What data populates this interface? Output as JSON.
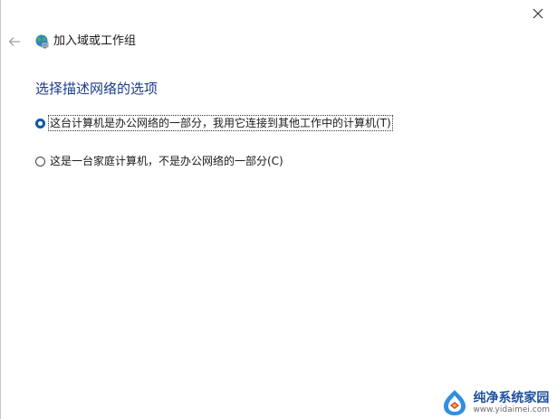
{
  "window": {
    "title": "加入域或工作组"
  },
  "main": {
    "heading": "选择描述网络的选项",
    "options": [
      {
        "label": "这台计算机是办公网络的一部分，我用它连接到其他工作中的计算机(T)",
        "selected": true
      },
      {
        "label": "这是一台家庭计算机，不是办公网络的一部分(C)",
        "selected": false
      }
    ]
  },
  "watermark": {
    "name": "纯净系统家园",
    "url": "www.yidaimei.com"
  },
  "colors": {
    "heading": "#1c3a8a",
    "radio_selected": "#0a58a8",
    "watermark": "#1e4fa0"
  },
  "icons": {
    "close": "close-icon",
    "back": "back-arrow-icon",
    "title": "network-globe-icon"
  }
}
